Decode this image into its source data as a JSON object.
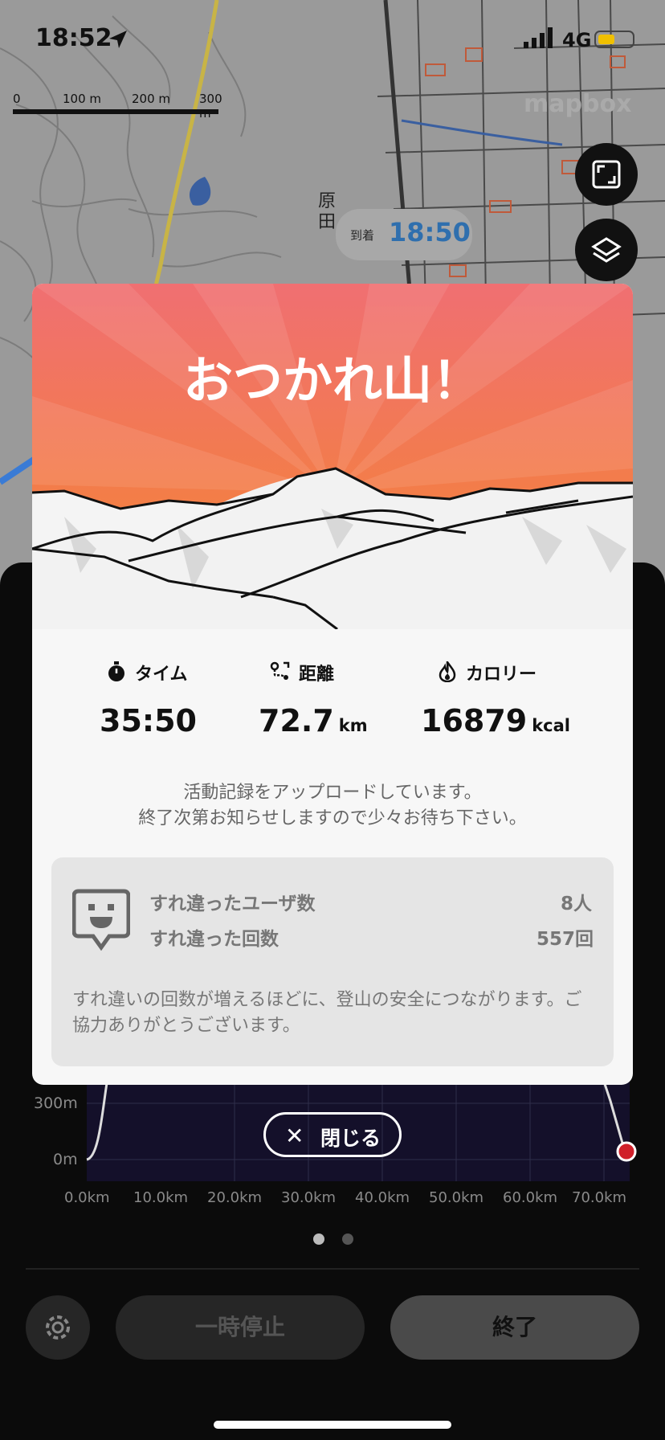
{
  "status_bar": {
    "time": "18:52",
    "network": "4G"
  },
  "map": {
    "scale_labels": [
      "0",
      "100 m",
      "200 m",
      "300 m"
    ],
    "attribution": "mapbox",
    "place_label": "原田",
    "eta": {
      "label": "到着",
      "time": "18:50"
    }
  },
  "chart": {
    "y_ticks": [
      "300m",
      "0m"
    ],
    "x_ticks": [
      "0.0km",
      "10.0km",
      "20.0km",
      "30.0km",
      "40.0km",
      "50.0km",
      "60.0km",
      "70.0km"
    ]
  },
  "controls": {
    "pause_label": "一時停止",
    "end_label": "終了",
    "close_label": "閉じる"
  },
  "modal": {
    "title": "おつかれ山！",
    "stats": [
      {
        "label": "タイム",
        "value": "35:50",
        "unit": "",
        "icon": "stopwatch-icon"
      },
      {
        "label": "距離",
        "value": "72.7",
        "unit": "km",
        "icon": "route-icon"
      },
      {
        "label": "カロリー",
        "value": "16879",
        "unit": "kcal",
        "icon": "flame-icon"
      }
    ],
    "upload_message_line1": "活動記録をアップロードしています。",
    "upload_message_line2": "終了次第お知らせしますので少々お待ち下さい。",
    "encounter": {
      "users_label": "すれ違ったユーザ数",
      "users_value": "8人",
      "count_label": "すれ違った回数",
      "count_value": "557回",
      "note": "すれ違いの回数が増えるほどに、登山の安全につながります。ご協力ありがとうございます。"
    }
  },
  "colors": {
    "hero_top": "#f06f72",
    "hero_bottom": "#f5862e",
    "eta_text": "#2f6fae",
    "end_marker": "#d0202a"
  }
}
